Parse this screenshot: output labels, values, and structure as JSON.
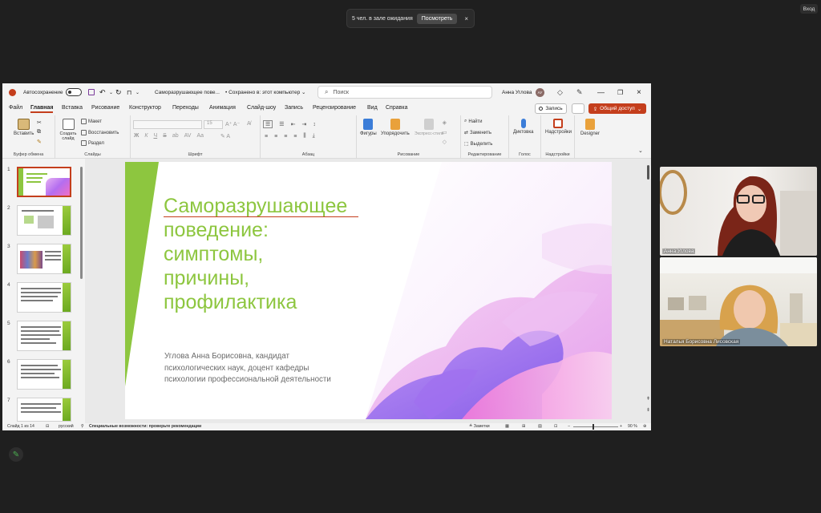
{
  "meeting": {
    "waiting_text": "5 чел. в зале ожидания",
    "view_button": "Посмотреть",
    "close_glyph": "×",
    "login_label": "Вход"
  },
  "app": {
    "autosave_label": "Автосохранение",
    "doc_title": "Саморазрушающее пове...",
    "save_status": "• Сохранено в: этот компьютер ⌄",
    "search_placeholder": "Поиск",
    "user_name": "Анна Углова",
    "user_initials": "АУ"
  },
  "menu": {
    "tabs": [
      "Файл",
      "Главная",
      "Вставка",
      "Рисование",
      "Конструктор",
      "Переходы",
      "Анимация",
      "Слайд-шоу",
      "Запись",
      "Рецензирование",
      "Вид",
      "Справка"
    ],
    "record_label": "Запись",
    "share_label": "Общий доступ"
  },
  "ribbon": {
    "paste": "Вставить",
    "clipboard_group": "Буфер обмена",
    "create_slide": "Создать слайд",
    "layout": "Макет",
    "reset": "Восстановить",
    "section": "Раздел",
    "slides_group": "Слайды",
    "font_group": "Шрифт",
    "paragraph_group": "Абзац",
    "shapes": "Фигуры",
    "arrange": "Упорядочить",
    "quick_styles": "Экспресс-стили",
    "drawing_group": "Рисование",
    "find": "Найти",
    "replace": "Заменить",
    "select": "Выделить",
    "editing_group": "Редактирование",
    "dictate": "Диктовка",
    "voice_group": "Голос",
    "addins": "Надстройки",
    "addins_group": "Надстройки",
    "designer": "Designer",
    "font_size": "15"
  },
  "slide": {
    "title": "Саморазрушающее\nповедение:\nсимптомы,\nпричины,\nпрофилактика",
    "subtitle": "Углова Анна Борисовна, кандидат\nпсихологических наук, доцент кафедры\nпсихологии профессиональной деятельности"
  },
  "thumbnails": [
    "1",
    "2",
    "3",
    "4",
    "5",
    "6",
    "7"
  ],
  "status": {
    "slide_info": "Слайд 1 из 14",
    "language": "русский",
    "accessibility": "Специальные возможности: проверьте рекомендации",
    "notes": "Заметки",
    "zoom": "90 %"
  },
  "participants": [
    {
      "name": "Анна Углова"
    },
    {
      "name": "Наталья Борисовна Лисовская"
    }
  ],
  "colors": {
    "accent": "#c43e1c",
    "title_green": "#8dc63f"
  }
}
